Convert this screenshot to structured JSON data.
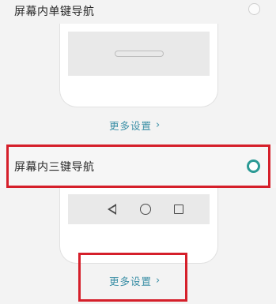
{
  "options": [
    {
      "label": "屏幕内单键导航",
      "selected": false,
      "more_link": "更多设置"
    },
    {
      "label": "屏幕内三键导航",
      "selected": true,
      "more_link": "更多设置"
    }
  ],
  "icons": {
    "chevron": "›",
    "nav_back": "back-triangle-icon",
    "nav_home": "home-circle-icon",
    "nav_recent": "recent-square-icon"
  },
  "colors": {
    "accent": "#2c9a95",
    "link": "#3b8fa6",
    "highlight": "#d51f2a"
  }
}
